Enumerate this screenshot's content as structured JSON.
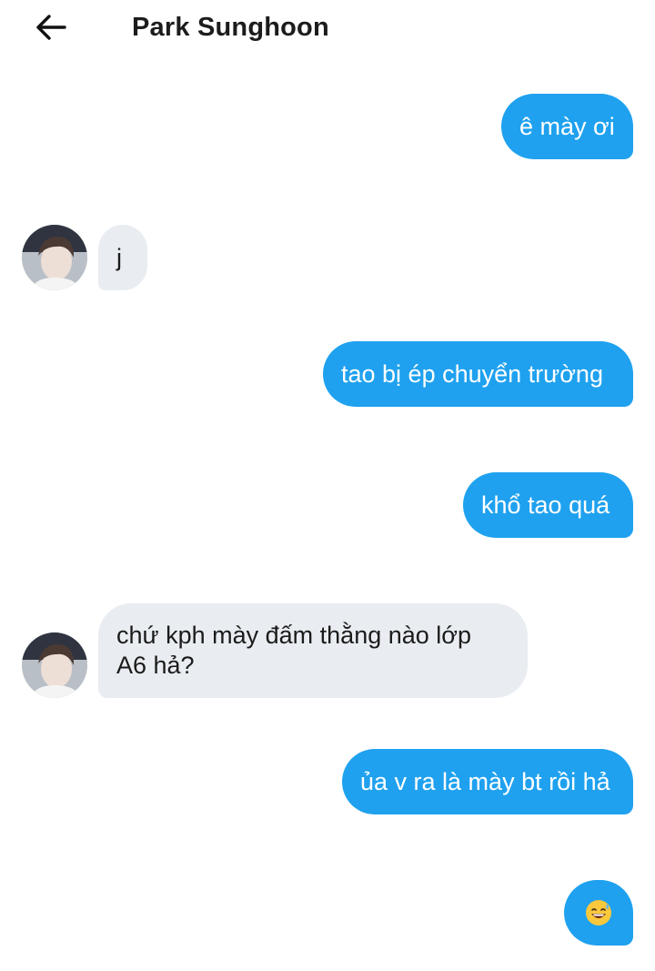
{
  "header": {
    "back_icon": "arrow-left-icon",
    "title": "Park Sunghoon"
  },
  "messages": [
    {
      "direction": "outgoing",
      "text": "ê mày ơi"
    },
    {
      "direction": "incoming",
      "text": "j",
      "avatar": "contact-avatar"
    },
    {
      "direction": "outgoing",
      "text": "tao bị ép chuyển trường"
    },
    {
      "direction": "outgoing",
      "text": "khổ tao quá"
    },
    {
      "direction": "incoming",
      "text": "chứ kph mày đấm thằng nào lớp A6 hả?",
      "line1": "chứ kph mày đấm thằng nào lớp",
      "line2": "A6 hả?",
      "avatar": "contact-avatar"
    },
    {
      "direction": "outgoing",
      "text": "ủa v ra là mày bt rồi hả"
    },
    {
      "direction": "outgoing",
      "text": "😅",
      "icon": "sweat-smile-emoji"
    }
  ],
  "colors": {
    "outgoing_bubble": "#1fa1ef",
    "incoming_bubble": "#e9edf1",
    "title_text": "#1c1c1c"
  }
}
